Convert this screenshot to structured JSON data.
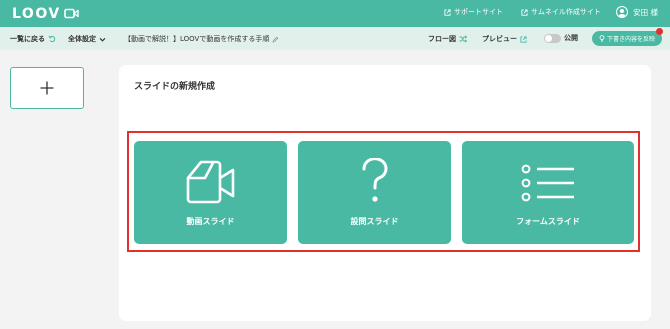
{
  "header": {
    "logo_text": "LOOV",
    "links": [
      {
        "label": "サポートサイト",
        "icon": "external-link-icon"
      },
      {
        "label": "サムネイル作成サイト",
        "icon": "external-link-icon"
      }
    ],
    "user_name": "安田 様"
  },
  "toolbar": {
    "back_label": "一覧に戻る",
    "settings_label": "全体設定",
    "document_title": "【動画で解説！】LOOVで動画を作成する手順",
    "flow_label": "フロー図",
    "preview_label": "プレビュー",
    "publish_label": "公開",
    "apply_label": "下書き内容を反映"
  },
  "sidebar": {
    "add_symbol": "+"
  },
  "main": {
    "title": "スライドの新規作成",
    "slide_types": [
      {
        "label": "動画スライド",
        "icon": "video-camera-icon"
      },
      {
        "label": "設問スライド",
        "icon": "question-mark-icon"
      },
      {
        "label": "フォームスライド",
        "icon": "list-icon"
      }
    ]
  },
  "colors": {
    "accent": "#49b9a4",
    "highlight": "#e0312d",
    "subbar": "#e2f0ec"
  }
}
